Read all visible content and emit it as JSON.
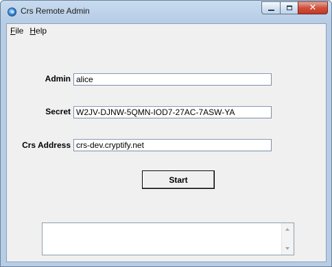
{
  "window": {
    "title": "Crs Remote Admin",
    "icon": "globe-icon",
    "controls": {
      "minimize": "minimize-icon",
      "maximize": "maximize-icon",
      "close": "close-icon"
    }
  },
  "menu": {
    "file_prefix": "F",
    "file_rest": "ile",
    "help_prefix": "H",
    "help_rest": "elp"
  },
  "form": {
    "admin_label": "Admin",
    "admin_value": "alice",
    "secret_label": "Secret",
    "secret_value": "W2JV-DJNW-5QMN-IOD7-27AC-7ASW-YA",
    "address_label": "Crs Address",
    "address_value": "crs-dev.cryptify.net",
    "start_label": "Start"
  },
  "log": {
    "text": ""
  },
  "colors": {
    "frame": "#b7cde6",
    "client": "#f0f0f0",
    "close_button": "#c23a27"
  }
}
